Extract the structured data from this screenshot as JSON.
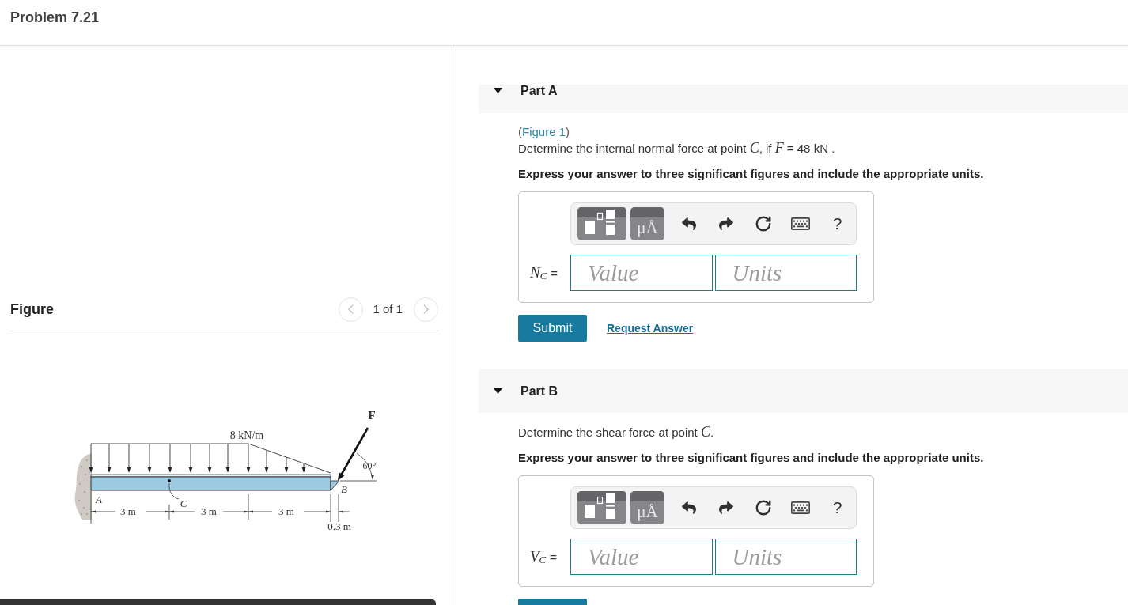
{
  "header": {
    "title": "Problem 7.21"
  },
  "figure_panel": {
    "heading": "Figure",
    "pager": {
      "previous": {
        "disabled": true
      },
      "status": "1 of 1",
      "next": {
        "disabled": true
      }
    },
    "diagram": {
      "load": "8 kN/m",
      "force": "F",
      "angle": "60°",
      "points": [
        "A",
        "C",
        "B"
      ],
      "spans": [
        "3 m",
        "3 m",
        "3 m"
      ],
      "offset": "0.3 m"
    }
  },
  "parts": [
    {
      "title": "Part A",
      "expanded": true,
      "figure_ref": {
        "open": "(",
        "link": "Figure 1",
        "close": ")"
      },
      "question": "Determine the internal normal force at point *C*, if *F* = 48 kN .",
      "instruction": "Express your answer to three significant figures and include the appropriate units.",
      "toolbar": [
        {
          "kind": "templates"
        },
        {
          "kind": "symbols",
          "label": "μÅ"
        },
        {
          "kind": "undo"
        },
        {
          "kind": "redo"
        },
        {
          "kind": "reset"
        },
        {
          "kind": "keyboard"
        },
        {
          "kind": "help",
          "label": "?"
        }
      ],
      "answer": {
        "label": "*N*$_{C}$ =",
        "value_placeholder": "Value",
        "units_placeholder": "Units"
      },
      "submit": "Submit",
      "request_answer": "Request Answer"
    },
    {
      "title": "Part B",
      "expanded": true,
      "question": "Determine the shear force at point *C*.",
      "instruction": "Express your answer to three significant figures and include the appropriate units.",
      "toolbar": [
        {
          "kind": "templates"
        },
        {
          "kind": "symbols",
          "label": "μÅ"
        },
        {
          "kind": "undo"
        },
        {
          "kind": "redo"
        },
        {
          "kind": "reset"
        },
        {
          "kind": "keyboard"
        },
        {
          "kind": "help",
          "label": "?"
        }
      ],
      "answer": {
        "label": "*V*$_{C}$ =",
        "value_placeholder": "Value",
        "units_placeholder": "Units"
      }
    }
  ]
}
